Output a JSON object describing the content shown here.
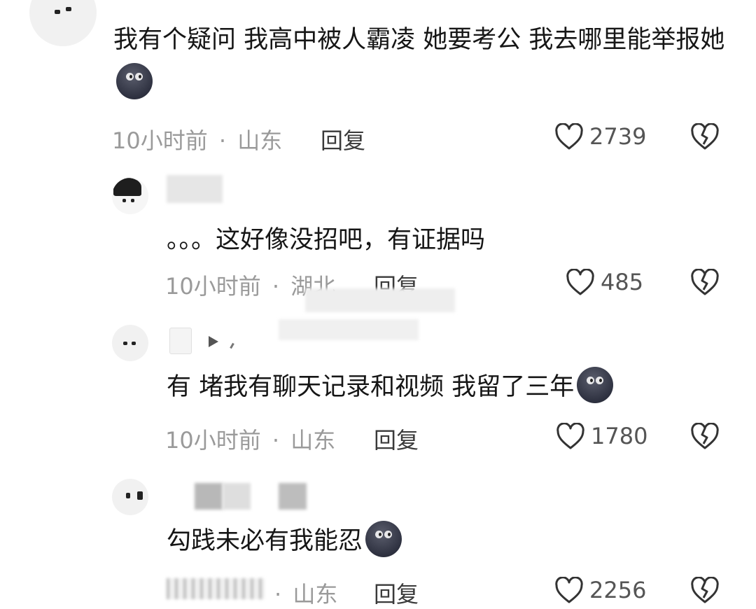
{
  "comments": [
    {
      "text": "我有个疑问 我高中被人霸凌 她要考公 我去哪里能举报她",
      "time": "10小时前",
      "separator": "·",
      "location": "山东",
      "reply_label": "回复",
      "likes": "2739"
    },
    {
      "text": "。。。这好像没招吧，有证据吗",
      "time": "10小时前",
      "separator": "·",
      "location": "湖北",
      "reply_label": "回复",
      "likes": "485"
    },
    {
      "text": "有 堵我有聊天记录和视频 我留了三年",
      "time": "10小时前",
      "separator": "·",
      "location": "山东",
      "reply_label": "回复",
      "likes": "1780"
    },
    {
      "text": "勾践未必有我能忍",
      "separator": "·",
      "location": "山东",
      "reply_label": "回复",
      "likes": "2256"
    }
  ],
  "icons": {
    "like": "heart-outline-icon",
    "dislike": "broken-heart-icon",
    "emoji": "peeking-face-emoji-icon"
  },
  "colors": {
    "text": "#161616",
    "meta": "#9a9a9a",
    "icon": "#333333"
  }
}
